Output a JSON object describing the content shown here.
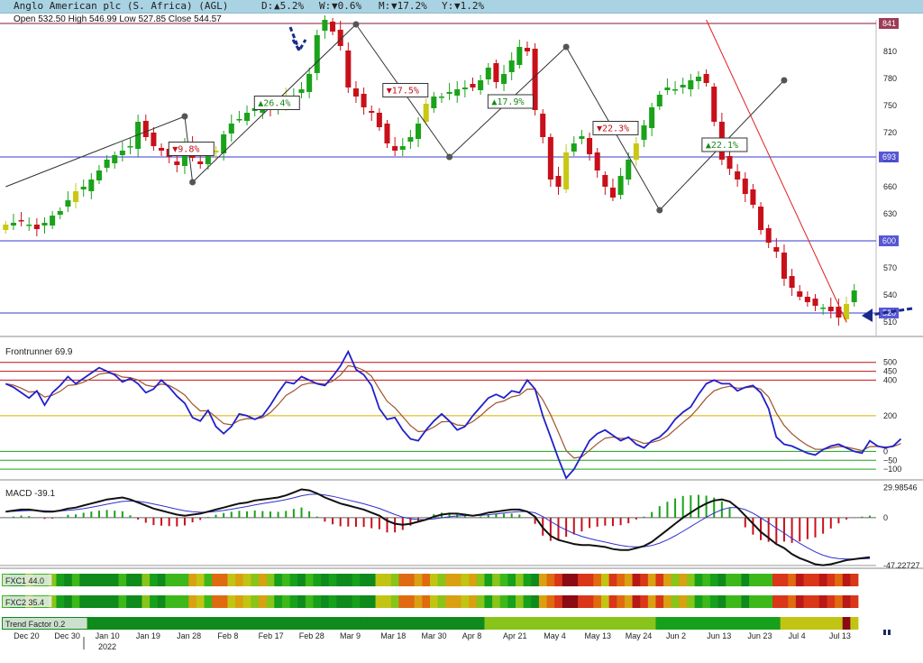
{
  "header": {
    "title": "Anglo American plc (S. Africa) (AGL)",
    "d_label": "D:",
    "d_value": "▲5.2%",
    "w_label": "W:",
    "w_value": "▼0.6%",
    "m_label": "M:",
    "m_value": "▼17.2%",
    "y_label": "Y:",
    "y_value": "▼1.2%"
  },
  "ohlc": "Open 532.50  High 546.99  Low 527.85  Close 544.57",
  "colors": {
    "up": "#1aa31a",
    "down": "#c8101a",
    "neutral": "#c8c812",
    "macd": "#111111",
    "signal": "#3030cc",
    "frontrunner": "#2020cc",
    "fr_signal": "#a0522d"
  },
  "chart_data": [
    {
      "type": "candlestick",
      "ylim": [
        495,
        845
      ],
      "yticks": [
        "510",
        "540",
        "570",
        "600",
        "630",
        "660",
        "690",
        "720",
        "750",
        "780",
        "810"
      ],
      "hlines": [
        {
          "value": 841,
          "label": "841",
          "color": "#8b1a3a"
        },
        {
          "value": 693,
          "label": "693",
          "color": "#3a3ad0"
        },
        {
          "value": 600,
          "label": "600",
          "color": "#3a3ad0"
        },
        {
          "value": 520,
          "label": "520",
          "color": "#3a3ad0"
        }
      ],
      "xlabels": [
        "Dec 20",
        "Dec 30",
        "Jan 10",
        "Jan 19",
        "Jan 28",
        "Feb 8",
        "Feb 17",
        "Feb 28",
        "Mar 9",
        "Mar 18",
        "Mar 30",
        "Apr 8",
        "Apr 21",
        "May 4",
        "May 13",
        "May 24",
        "Jun 2",
        "Jun 13",
        "Jun 23",
        "Jul 4",
        "Jul 13"
      ],
      "year_label": "2022",
      "closes": [
        618,
        620,
        622,
        618,
        613,
        620,
        628,
        633,
        645,
        655,
        660,
        668,
        678,
        690,
        695,
        700,
        705,
        732,
        715,
        705,
        700,
        693,
        684,
        705,
        692,
        685,
        694,
        700,
        718,
        730,
        735,
        742,
        747,
        748,
        746,
        752,
        760,
        760,
        768,
        785,
        828,
        845,
        832,
        816,
        770,
        760,
        748,
        742,
        726,
        708,
        700,
        705,
        715,
        730,
        752,
        760,
        760,
        765,
        768,
        770,
        770,
        778,
        792,
        776,
        785,
        800,
        815,
        810,
        745,
        715,
        668,
        660,
        698,
        708,
        716,
        696,
        678,
        660,
        648,
        672,
        690,
        708,
        728,
        748,
        762,
        770,
        768,
        773,
        778,
        782,
        775,
        732,
        690,
        680,
        668,
        652,
        640,
        612,
        598,
        588,
        558,
        548,
        538,
        532,
        528,
        526,
        522,
        515,
        530,
        545
      ],
      "swing_labels": [
        {
          "text": "▼9.8%",
          "dir": "down"
        },
        {
          "text": "▲26.4%",
          "dir": "up"
        },
        {
          "text": "▼17.5%",
          "dir": "down"
        },
        {
          "text": "▲17.9%",
          "dir": "up"
        },
        {
          "text": "▼22.3%",
          "dir": "down"
        },
        {
          "text": "▲22.1%",
          "dir": "up"
        }
      ],
      "swing_points": [
        {
          "i": 0,
          "v": 660
        },
        {
          "i": 23,
          "v": 738
        },
        {
          "i": 24,
          "v": 665
        },
        {
          "i": 45,
          "v": 840
        },
        {
          "i": 57,
          "v": 693
        },
        {
          "i": 72,
          "v": 815
        },
        {
          "i": 84,
          "v": 634
        },
        {
          "i": 100,
          "v": 778
        }
      ]
    },
    {
      "type": "line",
      "name": "Frontrunner 69.9",
      "ylim": [
        -160,
        620
      ],
      "levels": [
        {
          "value": 500,
          "label": "500"
        },
        {
          "value": 450,
          "label": "450"
        },
        {
          "value": 400,
          "label": "400"
        },
        {
          "value": 200,
          "label": "200"
        },
        {
          "value": 0,
          "label": "0"
        },
        {
          "value": -50,
          "label": "−50"
        },
        {
          "value": -100,
          "label": "−100"
        }
      ],
      "series": [
        {
          "name": "Frontrunner",
          "values": [
            380,
            360,
            330,
            300,
            340,
            260,
            330,
            370,
            420,
            380,
            410,
            440,
            470,
            450,
            430,
            390,
            410,
            380,
            330,
            350,
            400,
            360,
            310,
            270,
            190,
            170,
            230,
            140,
            100,
            140,
            210,
            200,
            180,
            200,
            260,
            330,
            390,
            380,
            420,
            400,
            380,
            370,
            420,
            480,
            560,
            460,
            430,
            370,
            240,
            180,
            190,
            120,
            70,
            60,
            120,
            170,
            210,
            170,
            120,
            140,
            200,
            250,
            300,
            320,
            300,
            340,
            330,
            400,
            350,
            200,
            80,
            -40,
            -150,
            -100,
            -20,
            60,
            100,
            120,
            90,
            60,
            80,
            40,
            20,
            60,
            80,
            120,
            180,
            220,
            250,
            320,
            380,
            400,
            380,
            380,
            340,
            360,
            370,
            330,
            240,
            80,
            40,
            30,
            10,
            -10,
            -20,
            10,
            30,
            40,
            20,
            0,
            -10,
            60,
            30,
            20,
            30,
            70
          ]
        }
      ]
    },
    {
      "type": "line",
      "name": "MACD -39.1",
      "yticks": [
        "29.98546",
        "0",
        "-47.22727"
      ],
      "series": [
        {
          "name": "MACD",
          "values": [
            6,
            7,
            8,
            8,
            7,
            6,
            6,
            7,
            9,
            10,
            12,
            14,
            16,
            18,
            19,
            20,
            18,
            15,
            12,
            9,
            7,
            5,
            3,
            2,
            3,
            4,
            6,
            8,
            10,
            12,
            14,
            15,
            17,
            18,
            19,
            20,
            22,
            25,
            28,
            27,
            24,
            20,
            17,
            14,
            12,
            10,
            8,
            5,
            2,
            -3,
            -6,
            -7,
            -6,
            -4,
            -2,
            1,
            3,
            4,
            4,
            3,
            2,
            3,
            5,
            6,
            7,
            8,
            8,
            6,
            1,
            -10,
            -18,
            -22,
            -24,
            -26,
            -27,
            -27,
            -28,
            -29,
            -31,
            -32,
            -32,
            -30,
            -28,
            -24,
            -18,
            -12,
            -6,
            0,
            5,
            10,
            14,
            17,
            18,
            16,
            10,
            2,
            -6,
            -14,
            -20,
            -26,
            -30,
            -36,
            -40,
            -43,
            -46,
            -47,
            -46,
            -44,
            -42,
            -41,
            -40,
            -39
          ]
        }
      ]
    },
    {
      "type": "heatmap",
      "name": "FXC1 44.0"
    },
    {
      "type": "heatmap",
      "name": "FXC2 35.4"
    },
    {
      "type": "heatmap",
      "name": "Trend Factor 0.2"
    }
  ]
}
